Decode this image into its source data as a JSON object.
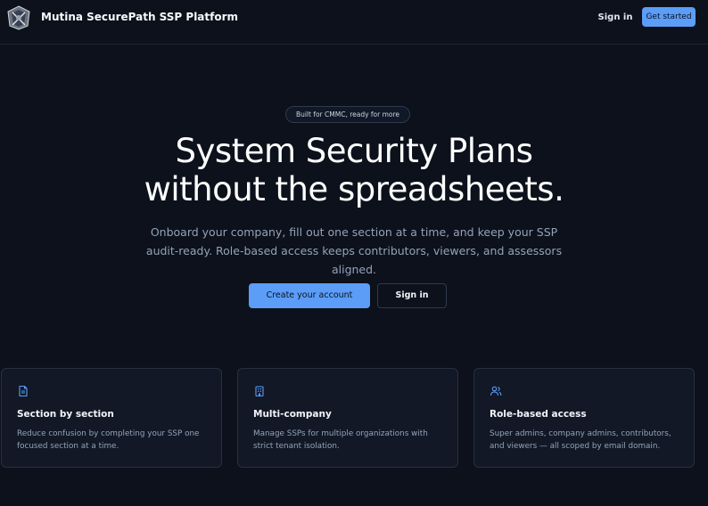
{
  "header": {
    "brand": "Mutina SecurePath SSP Platform",
    "logo_icon": "shield-logo-icon",
    "sign_in_label": "Sign in",
    "get_started_label": "Get started"
  },
  "hero": {
    "pill": "Built for CMMC, ready for more",
    "headline_line1": "System Security Plans",
    "headline_line2": "without the spreadsheets.",
    "subtext": "Onboard your company, fill out one section at a time, and keep your SSP audit-ready. Role-based access keeps contributors, viewers, and assessors aligned.",
    "primary_cta": "Create your account",
    "secondary_cta": "Sign in"
  },
  "features": [
    {
      "icon": "document-icon",
      "title": "Section by section",
      "description": "Reduce confusion by completing your SSP one focused section at a time."
    },
    {
      "icon": "building-icon",
      "title": "Multi-company",
      "description": "Manage SSPs for multiple organizations with strict tenant isolation."
    },
    {
      "icon": "users-icon",
      "title": "Role-based access",
      "description": "Super admins, company admins, contributors, and viewers — all scoped by email domain."
    }
  ],
  "colors": {
    "background": "#0c111b",
    "accent": "#5b9df7",
    "card": "#121826",
    "muted_text": "#94a3b8"
  }
}
